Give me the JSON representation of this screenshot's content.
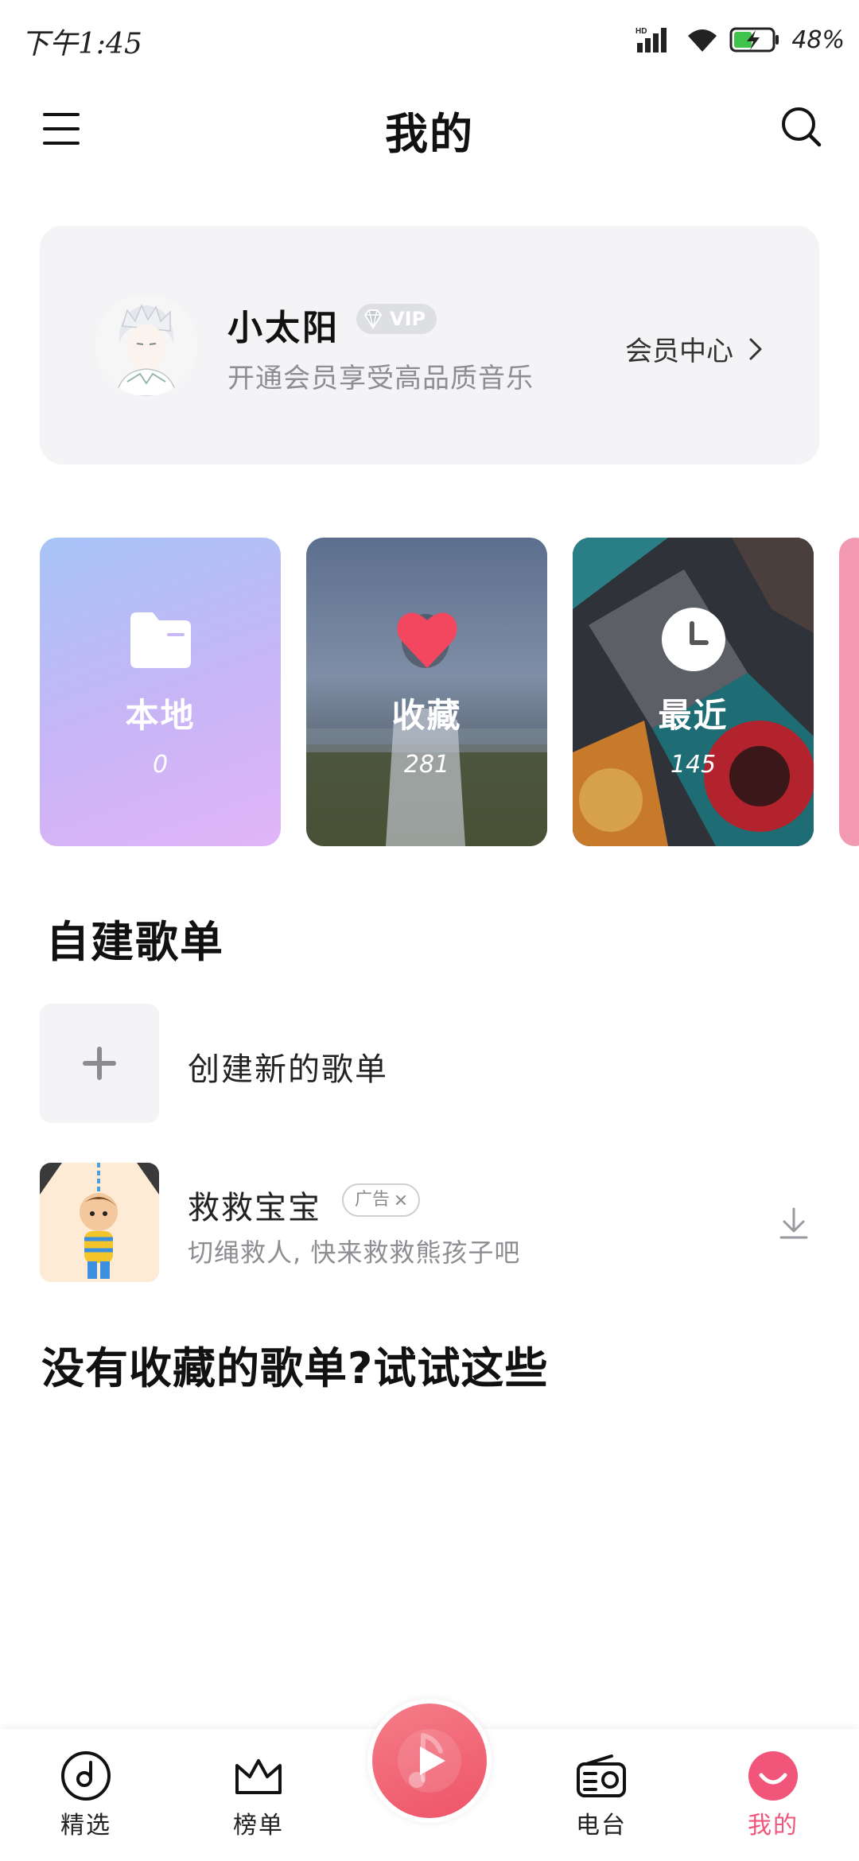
{
  "status_bar": {
    "time": "下午1:45",
    "battery": "48%"
  },
  "header": {
    "title": "我的"
  },
  "profile": {
    "name": "小太阳",
    "badge": "VIP",
    "subtitle": "开通会员享受高品质音乐",
    "member_center": "会员中心"
  },
  "tiles": [
    {
      "label": "本地",
      "count": "0",
      "icon": "folder-icon"
    },
    {
      "label": "收藏",
      "count": "281",
      "icon": "heart-icon"
    },
    {
      "label": "最近",
      "count": "145",
      "icon": "clock-icon"
    }
  ],
  "playlists": {
    "section_title": "自建歌单",
    "create_label": "创建新的歌单"
  },
  "ad": {
    "title": "救救宝宝",
    "tag": "广告",
    "subtitle": "切绳救人, 快来救救熊孩子吧"
  },
  "suggest": {
    "title": "没有收藏的歌单?试试这些"
  },
  "bottom_nav": [
    {
      "label": "精选",
      "icon": "disc-icon"
    },
    {
      "label": "榜单",
      "icon": "crown-icon"
    },
    {
      "label": "电台",
      "icon": "radio-icon"
    },
    {
      "label": "我的",
      "icon": "smile-icon"
    }
  ],
  "colors": {
    "accent": "#f1557a",
    "play_button": "#ee5468",
    "card_bg": "#f4f4f6"
  }
}
